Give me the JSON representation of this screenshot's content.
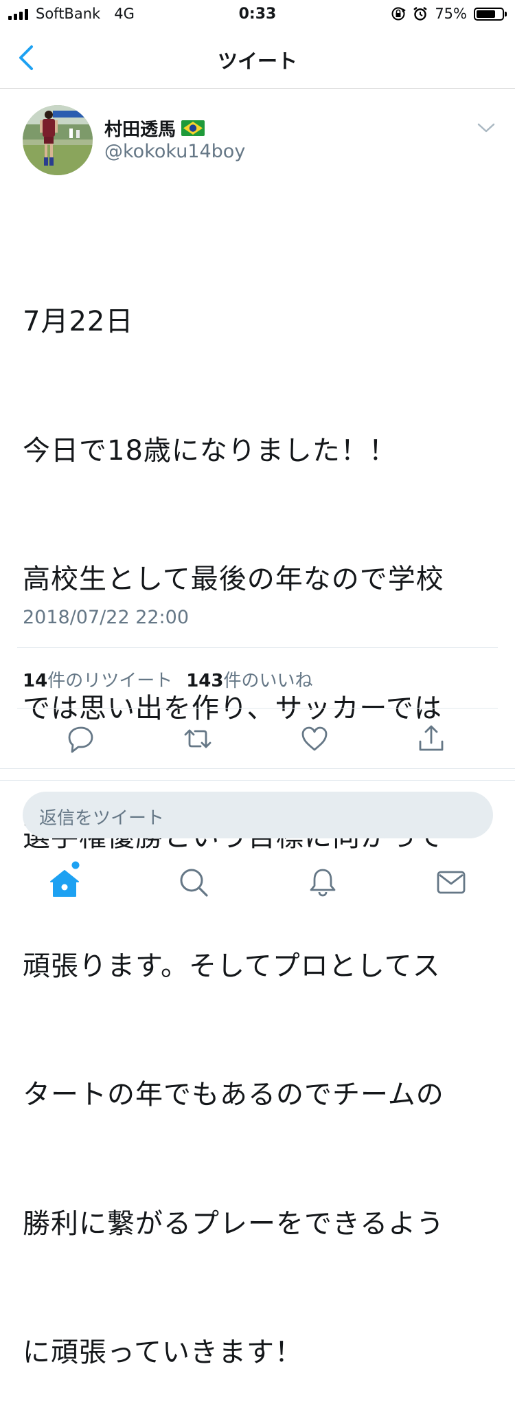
{
  "status_bar": {
    "carrier": "SoftBank",
    "network": "4G",
    "time": "0:33",
    "battery_percent": "75%",
    "battery_level": 0.75,
    "icons": [
      "signal-icon",
      "rotation-lock-icon",
      "alarm-icon",
      "battery-icon"
    ]
  },
  "nav": {
    "title": "ツイート",
    "back_icon": "chevron-left-icon"
  },
  "tweet": {
    "display_name": "村田透馬",
    "flag_icon": "brazil-flag-icon",
    "handle": "@kokoku14boy",
    "lines": [
      "7月22日",
      "今日で18歳になりました！！",
      "高校生として最後の年なので学校",
      "では思い出を作り、サッカーでは",
      "選手権優勝という目標に向かって",
      "頑張ります。そしてプロとしてス",
      "タートの年でもあるのでチームの",
      "勝利に繋がるプレーをできるよう",
      "に頑張っていきます！"
    ],
    "timestamp": "2018/07/22 22:00",
    "retweet_count": "14",
    "retweet_label": "件のリツイート",
    "like_count": "143",
    "like_label": "件のいいね"
  },
  "actions": [
    "reply-icon",
    "retweet-icon",
    "like-icon",
    "share-icon"
  ],
  "reply": {
    "placeholder": "返信をツイート"
  },
  "tabbar": {
    "items": [
      "home-icon",
      "search-icon",
      "notifications-icon",
      "messages-icon"
    ],
    "accent": "#1da1f2"
  },
  "colors": {
    "accent": "#1da1f2",
    "icon_gray": "#657786",
    "text": "#14171a"
  }
}
